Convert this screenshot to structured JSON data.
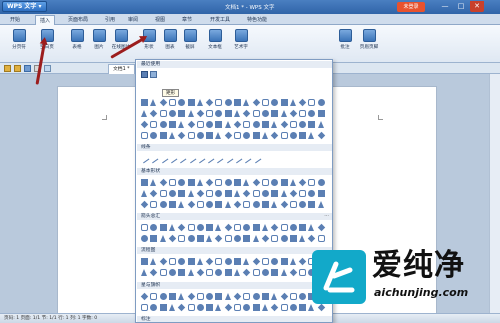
{
  "window": {
    "app_name": "WPS 文字",
    "title": "文档1 * - WPS 文字",
    "login_label": "未登录",
    "controls": [
      "—",
      "□",
      "✕"
    ]
  },
  "ribbon_tabs": [
    "开始",
    "插入",
    "页面布局",
    "引用",
    "审阅",
    "视图",
    "章节",
    "开发工具",
    "特色功能"
  ],
  "active_tab": "插入",
  "ribbon_buttons": [
    {
      "label": "分页符"
    },
    {
      "label": "空白页"
    },
    {
      "label": "表格"
    },
    {
      "label": "图片"
    },
    {
      "label": "在线图片"
    },
    {
      "label": "形状"
    },
    {
      "label": "图表"
    },
    {
      "label": "截屏"
    },
    {
      "label": "文本框"
    },
    {
      "label": "艺术字"
    },
    {
      "label": "批注"
    },
    {
      "label": "页眉页脚"
    }
  ],
  "doc_tab": {
    "label": "文档1 *"
  },
  "gallery": {
    "tooltip": "矩形",
    "sections": [
      {
        "title": "最近使用"
      },
      {
        "title": "线条"
      },
      {
        "title": "基本形状"
      },
      {
        "title": "箭头总汇"
      },
      {
        "title": "流程图"
      },
      {
        "title": "星与旗帜"
      },
      {
        "title": "标注"
      }
    ],
    "more_symbol": "···"
  },
  "status_bar": {
    "text": "页码: 1  页面: 1/1  节: 1/1  行: 1  列: 1  字数: 0"
  },
  "watermark": {
    "chinese": "爱纯净",
    "url": "aichunjing.com"
  },
  "colors": {
    "shape_fill": "#5b7fb3",
    "arrow": "#9c1d1d",
    "accent": "#2f64a8"
  }
}
